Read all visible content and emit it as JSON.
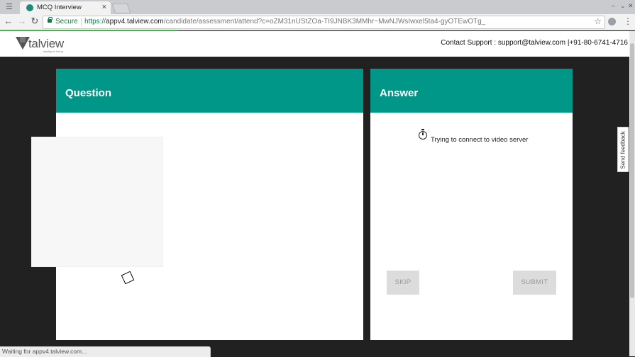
{
  "browser": {
    "tab_title": "MCQ Interview",
    "tab_close": "×",
    "secure_label": "Secure",
    "url_scheme": "https://",
    "url_host": "appv4.talview.com",
    "url_path": "/candidate/assessment/attend?c=oZM31nUStZOa-TI9JNBK3MMhr~MwNJWsIwxel5ta4-gyOTEwOTg_",
    "status_text": "Waiting for appv4.talview.com..."
  },
  "site": {
    "logo_text": "talview",
    "logo_tagline": "intelligent hiring",
    "support_text": "Contact Support : support@talview.com |+91-80-6741-4716"
  },
  "question_panel": {
    "title": "Question"
  },
  "answer_panel": {
    "title": "Answer",
    "connect_message": "Trying to connect to video server",
    "skip_label": "SKIP",
    "submit_label": "SUBMIT"
  },
  "feedback_label": "Send feedback",
  "colors": {
    "accent": "#009688",
    "page_bg": "#212121",
    "secure": "#0b8043"
  }
}
